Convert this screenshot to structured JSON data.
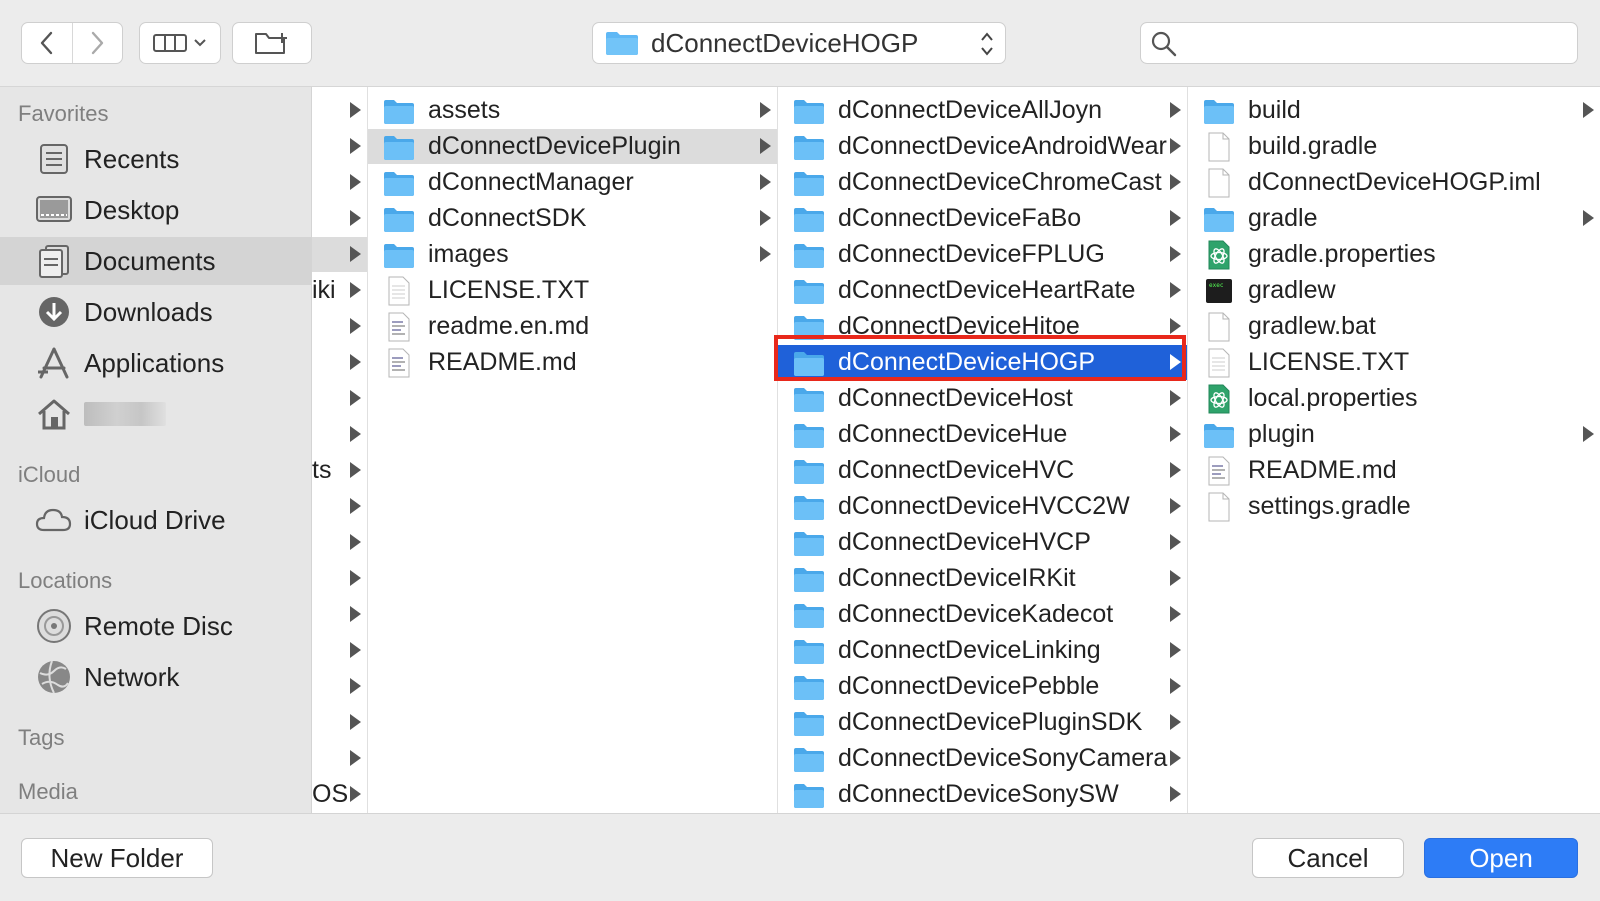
{
  "toolbar": {
    "path_label": "dConnectDeviceHOGP",
    "search_placeholder": ""
  },
  "sidebar": {
    "favorites_title": "Favorites",
    "favorites": [
      {
        "label": "Recents",
        "icon": "recents-icon"
      },
      {
        "label": "Desktop",
        "icon": "desktop-icon"
      },
      {
        "label": "Documents",
        "icon": "documents-icon",
        "selected": true
      },
      {
        "label": "Downloads",
        "icon": "downloads-icon"
      },
      {
        "label": "Applications",
        "icon": "applications-icon"
      },
      {
        "label": "",
        "icon": "home-icon"
      }
    ],
    "icloud_title": "iCloud",
    "icloud": [
      {
        "label": "iCloud Drive",
        "icon": "cloud-icon"
      }
    ],
    "locations_title": "Locations",
    "locations": [
      {
        "label": "Remote Disc",
        "icon": "disc-icon"
      },
      {
        "label": "Network",
        "icon": "network-icon"
      }
    ],
    "tags_title": "Tags",
    "media_title": "Media"
  },
  "column0": {
    "partial_names": [
      "",
      "",
      "",
      "",
      "",
      "iki",
      "",
      "",
      "",
      "",
      "ts",
      "",
      "",
      "",
      "",
      "",
      "",
      "",
      "",
      "OS"
    ]
  },
  "column1": {
    "items": [
      {
        "name": "assets",
        "type": "folder"
      },
      {
        "name": "dConnectDevicePlugin",
        "type": "folder",
        "highlight": true
      },
      {
        "name": "dConnectManager",
        "type": "folder"
      },
      {
        "name": "dConnectSDK",
        "type": "folder"
      },
      {
        "name": "images",
        "type": "folder"
      },
      {
        "name": "LICENSE.TXT",
        "type": "text"
      },
      {
        "name": "readme.en.md",
        "type": "md"
      },
      {
        "name": "README.md",
        "type": "md"
      }
    ]
  },
  "column2": {
    "items": [
      {
        "name": "dConnectDeviceAllJoyn"
      },
      {
        "name": "dConnectDeviceAndroidWear"
      },
      {
        "name": "dConnectDeviceChromeCast"
      },
      {
        "name": "dConnectDeviceFaBo"
      },
      {
        "name": "dConnectDeviceFPLUG"
      },
      {
        "name": "dConnectDeviceHeartRate"
      },
      {
        "name": "dConnectDeviceHitoe"
      },
      {
        "name": "dConnectDeviceHOGP",
        "selected": true
      },
      {
        "name": "dConnectDeviceHost"
      },
      {
        "name": "dConnectDeviceHue"
      },
      {
        "name": "dConnectDeviceHVC"
      },
      {
        "name": "dConnectDeviceHVCC2W"
      },
      {
        "name": "dConnectDeviceHVCP"
      },
      {
        "name": "dConnectDeviceIRKit"
      },
      {
        "name": "dConnectDeviceKadecot"
      },
      {
        "name": "dConnectDeviceLinking"
      },
      {
        "name": "dConnectDevicePebble"
      },
      {
        "name": "dConnectDevicePluginSDK"
      },
      {
        "name": "dConnectDeviceSonyCamera"
      },
      {
        "name": "dConnectDeviceSonySW"
      }
    ]
  },
  "column3": {
    "items": [
      {
        "name": "build",
        "type": "folder"
      },
      {
        "name": "build.gradle",
        "type": "blank"
      },
      {
        "name": "dConnectDeviceHOGP.iml",
        "type": "blank"
      },
      {
        "name": "gradle",
        "type": "folder"
      },
      {
        "name": "gradle.properties",
        "type": "atom"
      },
      {
        "name": "gradlew",
        "type": "exec"
      },
      {
        "name": "gradlew.bat",
        "type": "blank"
      },
      {
        "name": "LICENSE.TXT",
        "type": "text"
      },
      {
        "name": "local.properties",
        "type": "atom"
      },
      {
        "name": "plugin",
        "type": "folder"
      },
      {
        "name": "README.md",
        "type": "md"
      },
      {
        "name": "settings.gradle",
        "type": "blank"
      }
    ]
  },
  "buttons": {
    "new_folder": "New Folder",
    "cancel": "Cancel",
    "open": "Open"
  },
  "colors": {
    "selection": "#1f61d9",
    "folder": "#5fb8f5",
    "open_button": "#2d7cf6",
    "annotation": "#e8281b"
  }
}
